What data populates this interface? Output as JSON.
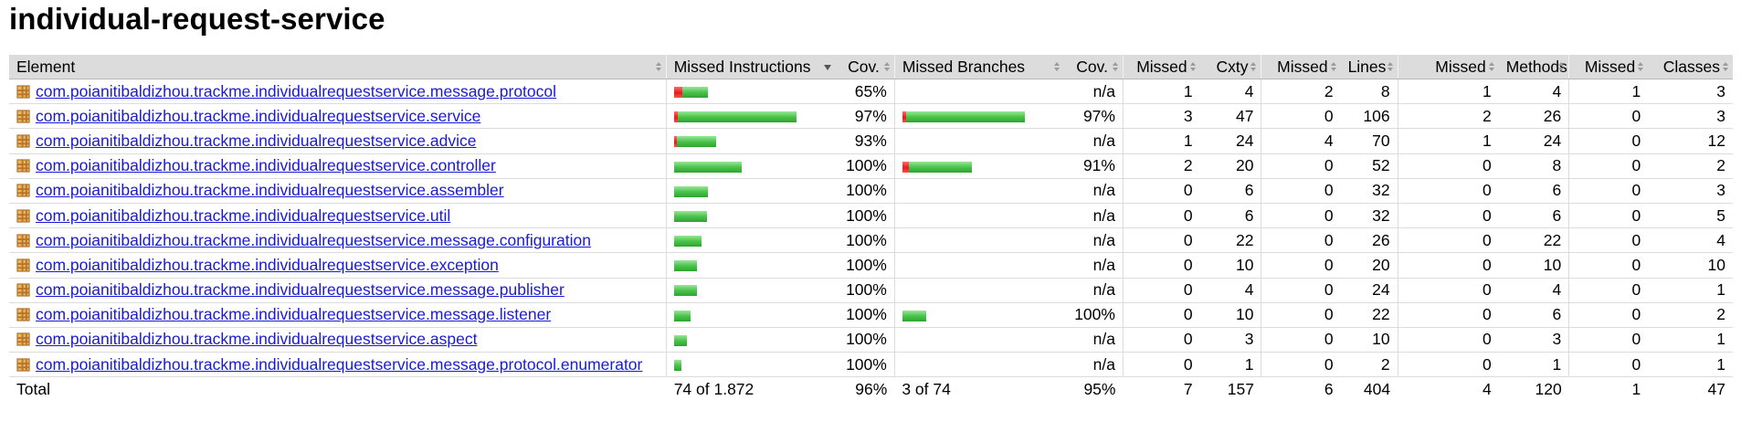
{
  "title": "individual-request-service",
  "headers": {
    "element": "Element",
    "missed_instructions": "Missed Instructions",
    "cov1": "Cov.",
    "missed_branches": "Missed Branches",
    "cov2": "Cov.",
    "missed_cxty": "Missed",
    "cxty": "Cxty",
    "missed_lines": "Missed",
    "lines": "Lines",
    "missed_methods": "Missed",
    "methods": "Methods",
    "missed_classes": "Missed",
    "classes": "Classes"
  },
  "rows": [
    {
      "name": "com.poianitibaldizhou.trackme.individualrequestservice.message.protocol",
      "instr_missed_frac": 0.25,
      "instr_total": 45,
      "instr_cov": "65%",
      "br_missed_frac": null,
      "br_total": 0,
      "br_cov": "n/a",
      "m_cxty": "1",
      "cxty": "4",
      "m_lines": "2",
      "lines": "8",
      "m_methods": "1",
      "methods": "4",
      "m_classes": "1",
      "classes": "3"
    },
    {
      "name": "com.poianitibaldizhou.trackme.individualrequestservice.service",
      "instr_missed_frac": 0.03,
      "instr_total": 164,
      "instr_cov": "97%",
      "br_missed_frac": 0.03,
      "br_total": 164,
      "br_cov": "97%",
      "m_cxty": "3",
      "cxty": "47",
      "m_lines": "0",
      "lines": "106",
      "m_methods": "2",
      "methods": "26",
      "m_classes": "0",
      "classes": "3"
    },
    {
      "name": "com.poianitibaldizhou.trackme.individualrequestservice.advice",
      "instr_missed_frac": 0.07,
      "instr_total": 56,
      "instr_cov": "93%",
      "br_missed_frac": null,
      "br_total": 0,
      "br_cov": "n/a",
      "m_cxty": "1",
      "cxty": "24",
      "m_lines": "4",
      "lines": "70",
      "m_methods": "1",
      "methods": "24",
      "m_classes": "0",
      "classes": "12"
    },
    {
      "name": "com.poianitibaldizhou.trackme.individualrequestservice.controller",
      "instr_missed_frac": 0,
      "instr_total": 90,
      "instr_cov": "100%",
      "br_missed_frac": 0.09,
      "br_total": 93,
      "br_cov": "91%",
      "m_cxty": "2",
      "cxty": "20",
      "m_lines": "0",
      "lines": "52",
      "m_methods": "0",
      "methods": "8",
      "m_classes": "0",
      "classes": "2"
    },
    {
      "name": "com.poianitibaldizhou.trackme.individualrequestservice.assembler",
      "instr_missed_frac": 0,
      "instr_total": 45,
      "instr_cov": "100%",
      "br_missed_frac": null,
      "br_total": 0,
      "br_cov": "n/a",
      "m_cxty": "0",
      "cxty": "6",
      "m_lines": "0",
      "lines": "32",
      "m_methods": "0",
      "methods": "6",
      "m_classes": "0",
      "classes": "3"
    },
    {
      "name": "com.poianitibaldizhou.trackme.individualrequestservice.util",
      "instr_missed_frac": 0,
      "instr_total": 44,
      "instr_cov": "100%",
      "br_missed_frac": null,
      "br_total": 0,
      "br_cov": "n/a",
      "m_cxty": "0",
      "cxty": "6",
      "m_lines": "0",
      "lines": "32",
      "m_methods": "0",
      "methods": "6",
      "m_classes": "0",
      "classes": "5"
    },
    {
      "name": "com.poianitibaldizhou.trackme.individualrequestservice.message.configuration",
      "instr_missed_frac": 0,
      "instr_total": 36,
      "instr_cov": "100%",
      "br_missed_frac": null,
      "br_total": 0,
      "br_cov": "n/a",
      "m_cxty": "0",
      "cxty": "22",
      "m_lines": "0",
      "lines": "26",
      "m_methods": "0",
      "methods": "22",
      "m_classes": "0",
      "classes": "4"
    },
    {
      "name": "com.poianitibaldizhou.trackme.individualrequestservice.exception",
      "instr_missed_frac": 0,
      "instr_total": 30,
      "instr_cov": "100%",
      "br_missed_frac": null,
      "br_total": 0,
      "br_cov": "n/a",
      "m_cxty": "0",
      "cxty": "10",
      "m_lines": "0",
      "lines": "20",
      "m_methods": "0",
      "methods": "10",
      "m_classes": "0",
      "classes": "10"
    },
    {
      "name": "com.poianitibaldizhou.trackme.individualrequestservice.message.publisher",
      "instr_missed_frac": 0,
      "instr_total": 30,
      "instr_cov": "100%",
      "br_missed_frac": null,
      "br_total": 0,
      "br_cov": "n/a",
      "m_cxty": "0",
      "cxty": "4",
      "m_lines": "0",
      "lines": "24",
      "m_methods": "0",
      "methods": "4",
      "m_classes": "0",
      "classes": "1"
    },
    {
      "name": "com.poianitibaldizhou.trackme.individualrequestservice.message.listener",
      "instr_missed_frac": 0,
      "instr_total": 22,
      "instr_cov": "100%",
      "br_missed_frac": 0,
      "br_total": 32,
      "br_cov": "100%",
      "m_cxty": "0",
      "cxty": "10",
      "m_lines": "0",
      "lines": "22",
      "m_methods": "0",
      "methods": "6",
      "m_classes": "0",
      "classes": "2"
    },
    {
      "name": "com.poianitibaldizhou.trackme.individualrequestservice.aspect",
      "instr_missed_frac": 0,
      "instr_total": 17,
      "instr_cov": "100%",
      "br_missed_frac": null,
      "br_total": 0,
      "br_cov": "n/a",
      "m_cxty": "0",
      "cxty": "3",
      "m_lines": "0",
      "lines": "10",
      "m_methods": "0",
      "methods": "3",
      "m_classes": "0",
      "classes": "1"
    },
    {
      "name": "com.poianitibaldizhou.trackme.individualrequestservice.message.protocol.enumerator",
      "instr_missed_frac": 0,
      "instr_total": 10,
      "instr_cov": "100%",
      "br_missed_frac": null,
      "br_total": 0,
      "br_cov": "n/a",
      "m_cxty": "0",
      "cxty": "1",
      "m_lines": "0",
      "lines": "2",
      "m_methods": "0",
      "methods": "1",
      "m_classes": "0",
      "classes": "1"
    }
  ],
  "totals": {
    "label": "Total",
    "instr": "74 of 1.872",
    "instr_cov": "96%",
    "br": "3 of 74",
    "br_cov": "95%",
    "m_cxty": "7",
    "cxty": "157",
    "m_lines": "6",
    "lines": "404",
    "m_methods": "4",
    "methods": "120",
    "m_classes": "1",
    "classes": "47"
  },
  "colors": {
    "link": "#1a1ad6",
    "missed": "#e81a1a",
    "covered": "#4cc34c",
    "header_bg": "#dcdcdc"
  },
  "icons": {
    "package": "package-icon",
    "sort": "sort-arrows-icon",
    "sort_active": "sort-descending-icon"
  }
}
